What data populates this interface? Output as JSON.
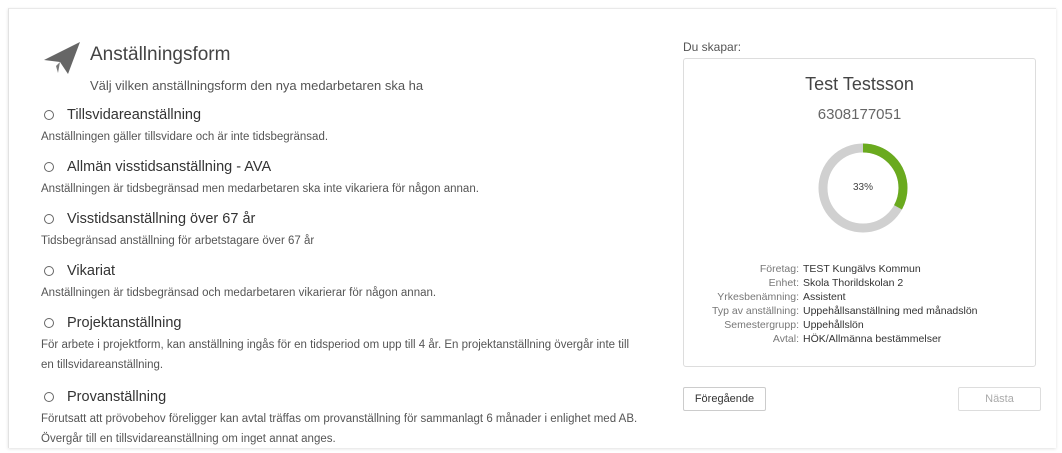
{
  "header": {
    "title": "Anställningsform",
    "subtitle": "Välj vilken anställningsform den nya medarbetaren ska ha",
    "icon": "paper-plane-icon"
  },
  "options": [
    {
      "label": "Tillsvidareanställning",
      "description": "Anställningen gäller tillsvidare och är inte tidsbegränsad."
    },
    {
      "label": "Allmän visstidsanställning - AVA",
      "description": "Anställningen är tidsbegränsad men medarbetaren ska inte vikariera för någon annan."
    },
    {
      "label": "Visstidsanställning över 67 år",
      "description": "Tidsbegränsad anställning för arbetstagare över 67 år"
    },
    {
      "label": "Vikariat",
      "description": "Anställningen är tidsbegränsad och medarbetaren vikarierar för någon annan."
    },
    {
      "label": "Projektanställning",
      "description": "För arbete i projektform, kan anställning ingås för en tidsperiod om upp till 4 år. En projektanställning övergår inte till en tillsvidareanställning."
    },
    {
      "label": "Provanställning",
      "description": "Förutsatt att prövobehov föreligger kan avtal träffas om provanställning för sammanlagt 6 månader i enlighet med AB. Övergår till en tillsvidareanställning om inget annat anges."
    }
  ],
  "summary": {
    "label": "Du skapar:",
    "name": "Test Testsson",
    "id_number": "6308177051",
    "progress_text": "33%",
    "progress_fraction": 0.33,
    "details": [
      {
        "key": "Företag:",
        "value": "TEST Kungälvs Kommun"
      },
      {
        "key": "Enhet:",
        "value": "Skola Thorildskolan 2"
      },
      {
        "key": "Yrkesbenämning:",
        "value": "Assistent"
      },
      {
        "key": "Typ av anställning:",
        "value": "Uppehållsanställning med månadslön"
      },
      {
        "key": "Semestergrupp:",
        "value": "Uppehållslön"
      },
      {
        "key": "Avtal:",
        "value": "HÖK/Allmänna bestämmelser"
      }
    ]
  },
  "buttons": {
    "previous": "Föregående",
    "next": "Nästa"
  },
  "colors": {
    "progress_fill": "#6aaa1e",
    "progress_track": "#d0d0d0",
    "icon": "#666666"
  }
}
